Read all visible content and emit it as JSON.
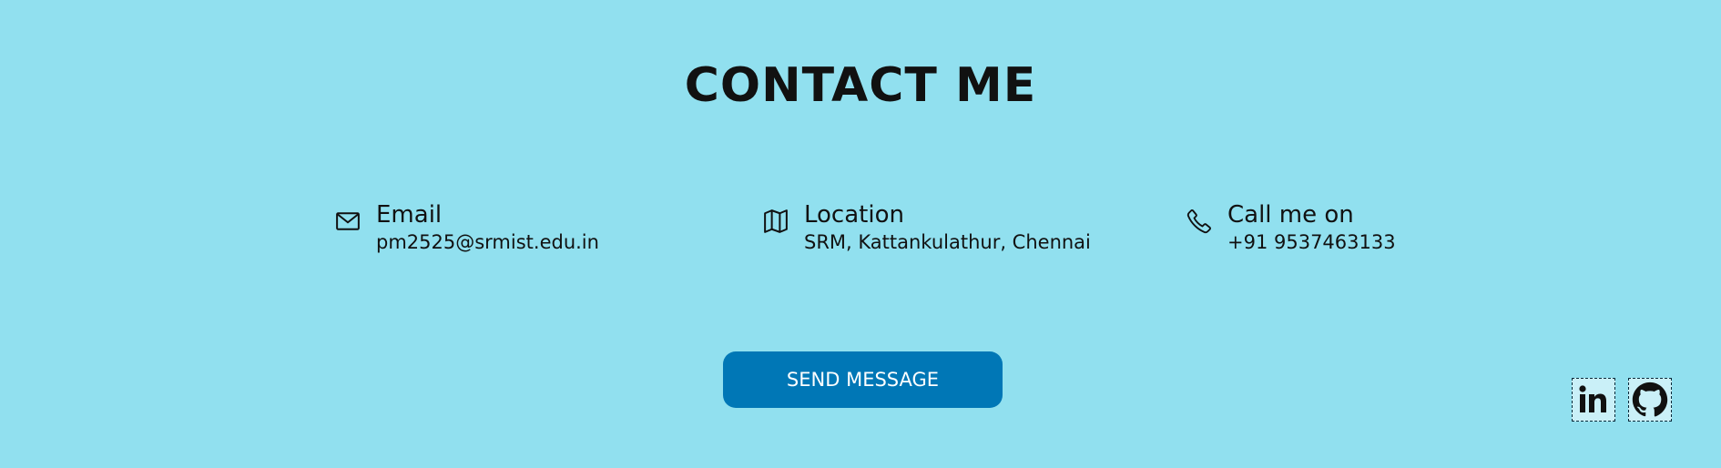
{
  "title": "CONTACT ME",
  "contacts": [
    {
      "label": "Email",
      "value": "pm2525@srmist.edu.in",
      "icon": "envelope-icon"
    },
    {
      "label": "Location",
      "value": "SRM, Kattankulathur, Chennai",
      "icon": "map-icon"
    },
    {
      "label": "Call me on",
      "value": "+91 9537463133",
      "icon": "phone-icon"
    }
  ],
  "button": {
    "label": "SEND MESSAGE"
  },
  "social": [
    {
      "name": "LinkedIn",
      "icon": "linkedin-icon"
    },
    {
      "name": "GitHub",
      "icon": "github-icon"
    }
  ],
  "colors": {
    "background": "#91E0EF",
    "button": "#0077B6",
    "button_text": "#FFFFFF",
    "social_bg": "#CAF0F8",
    "text": "#111111"
  }
}
